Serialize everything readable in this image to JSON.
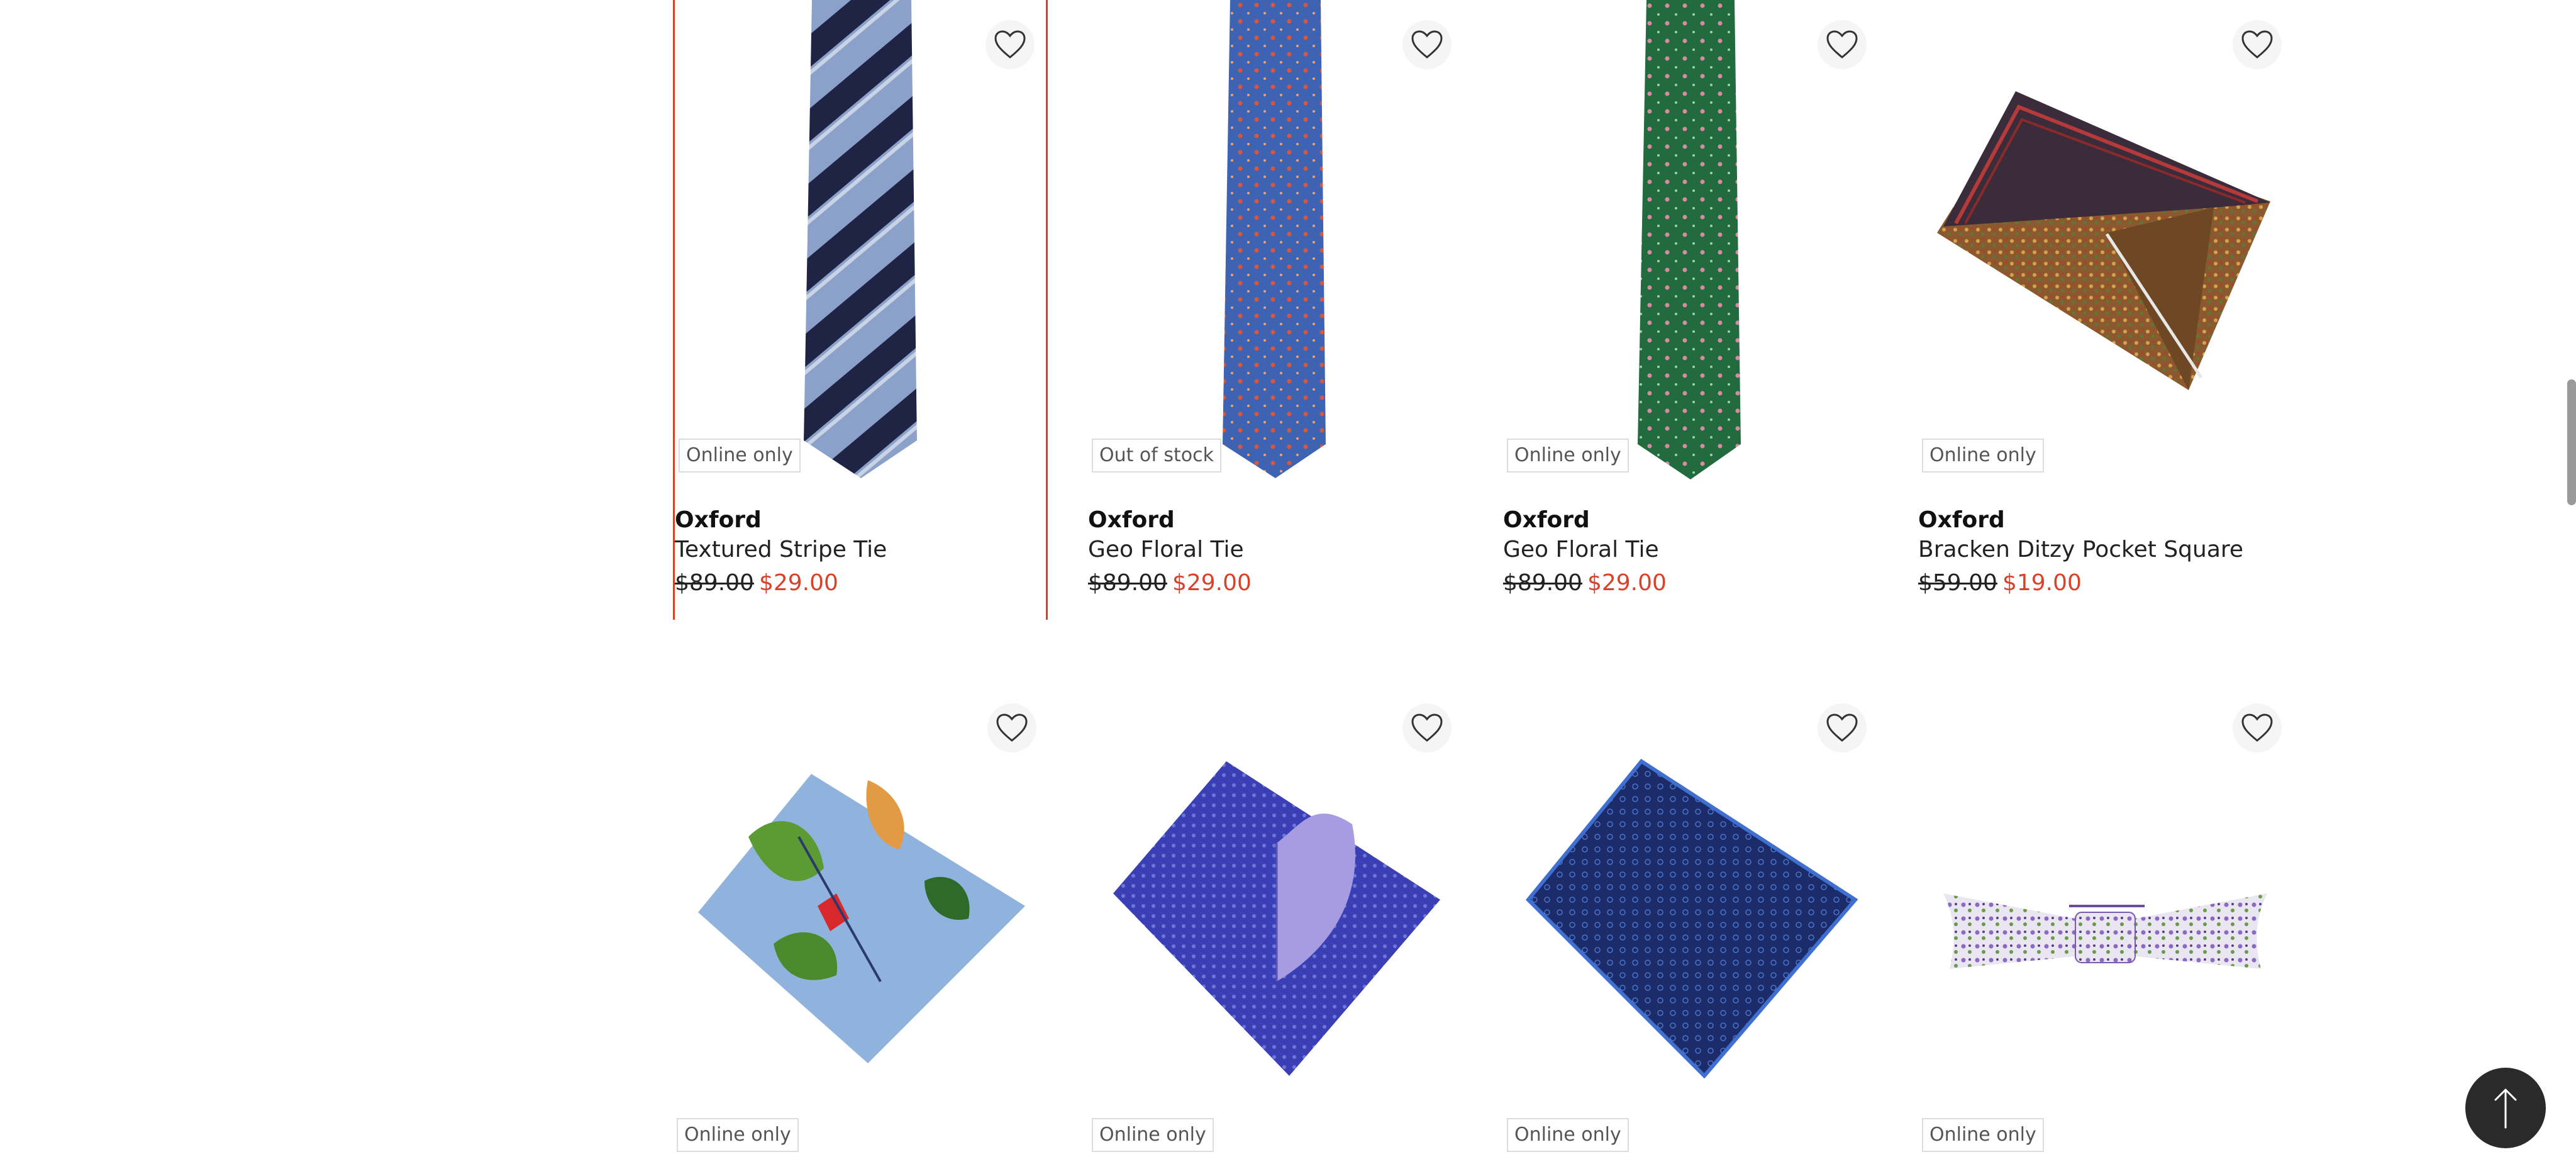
{
  "products": [
    {
      "brand": "Oxford",
      "name": "Textured Stripe Tie",
      "was": "$89.00",
      "now": "$29.00",
      "badge": "Online only",
      "image": "stripe-tie-image"
    },
    {
      "brand": "Oxford",
      "name": "Geo Floral Tie",
      "was": "$89.00",
      "now": "$29.00",
      "badge": "Out of stock",
      "image": "blue-floral-tie-image"
    },
    {
      "brand": "Oxford",
      "name": "Geo Floral Tie",
      "was": "$89.00",
      "now": "$29.00",
      "badge": "Online only",
      "image": "green-floral-tie-image"
    },
    {
      "brand": "Oxford",
      "name": "Bracken Ditzy Pocket Square",
      "was": "$59.00",
      "now": "$19.00",
      "badge": "Online only",
      "image": "ditzy-pocket-square-image"
    },
    {
      "badge": "Online only",
      "image": "tropical-pocket-square-image"
    },
    {
      "badge": "Online only",
      "image": "blue-purple-pocket-square-image"
    },
    {
      "badge": "Online only",
      "image": "navy-geo-pocket-square-image"
    },
    {
      "badge": "Online only",
      "image": "floral-bow-tie-image"
    }
  ],
  "icons": {
    "wishlist": "heart-icon",
    "back_to_top": "arrow-up-icon"
  },
  "colors": {
    "sale_price": "#d9412a",
    "selected_outline": "#d9412a",
    "back_to_top_bg": "#2a2a2a"
  }
}
